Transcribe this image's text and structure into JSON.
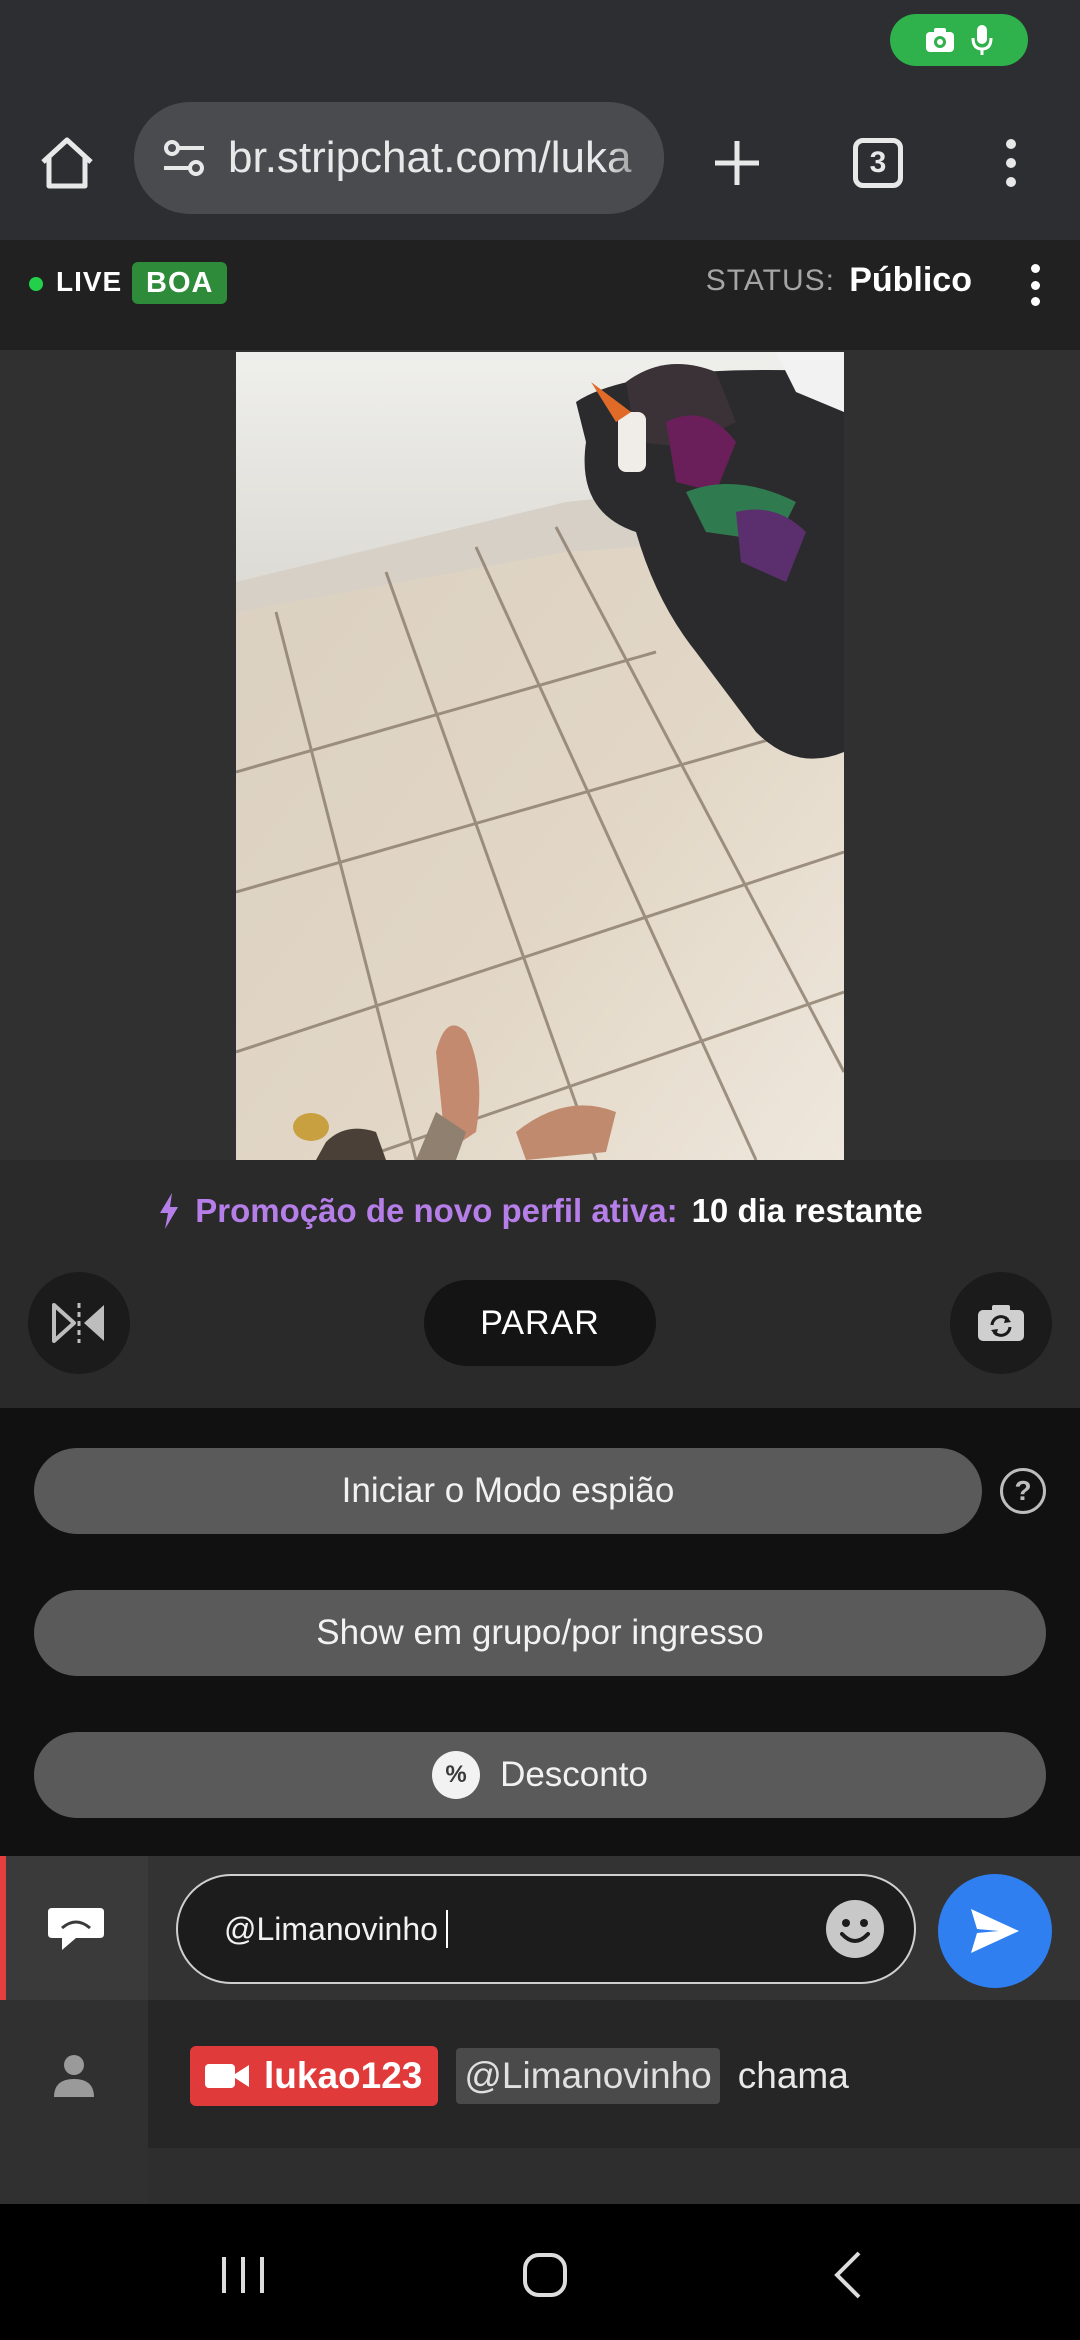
{
  "browser": {
    "url": "br.stripchat.com/luka",
    "tab_count": "3"
  },
  "live_header": {
    "live_label": "LIVE",
    "badge": "BOA",
    "status_label": "STATUS:",
    "status_value": "Público"
  },
  "promo": {
    "label": "Promoção de novo perfil ativa:",
    "value": "10 dia restante"
  },
  "controls": {
    "stop_label": "PARAR"
  },
  "actions": {
    "spy_mode": "Iniciar o Modo espião",
    "help": "?",
    "group_show": "Show em grupo/por ingresso",
    "discount": "Desconto",
    "discount_badge": "%"
  },
  "chat": {
    "input_value": "@Limanovinho",
    "message": {
      "username": "lukao123",
      "mention": "@Limanovinho",
      "text": "chama"
    }
  },
  "colors": {
    "live_green": "#22d04a",
    "badge_green": "#2e8b39",
    "promo_purple": "#b57ee8",
    "user_red": "#e03a3a",
    "send_blue": "#2f7ff0"
  }
}
